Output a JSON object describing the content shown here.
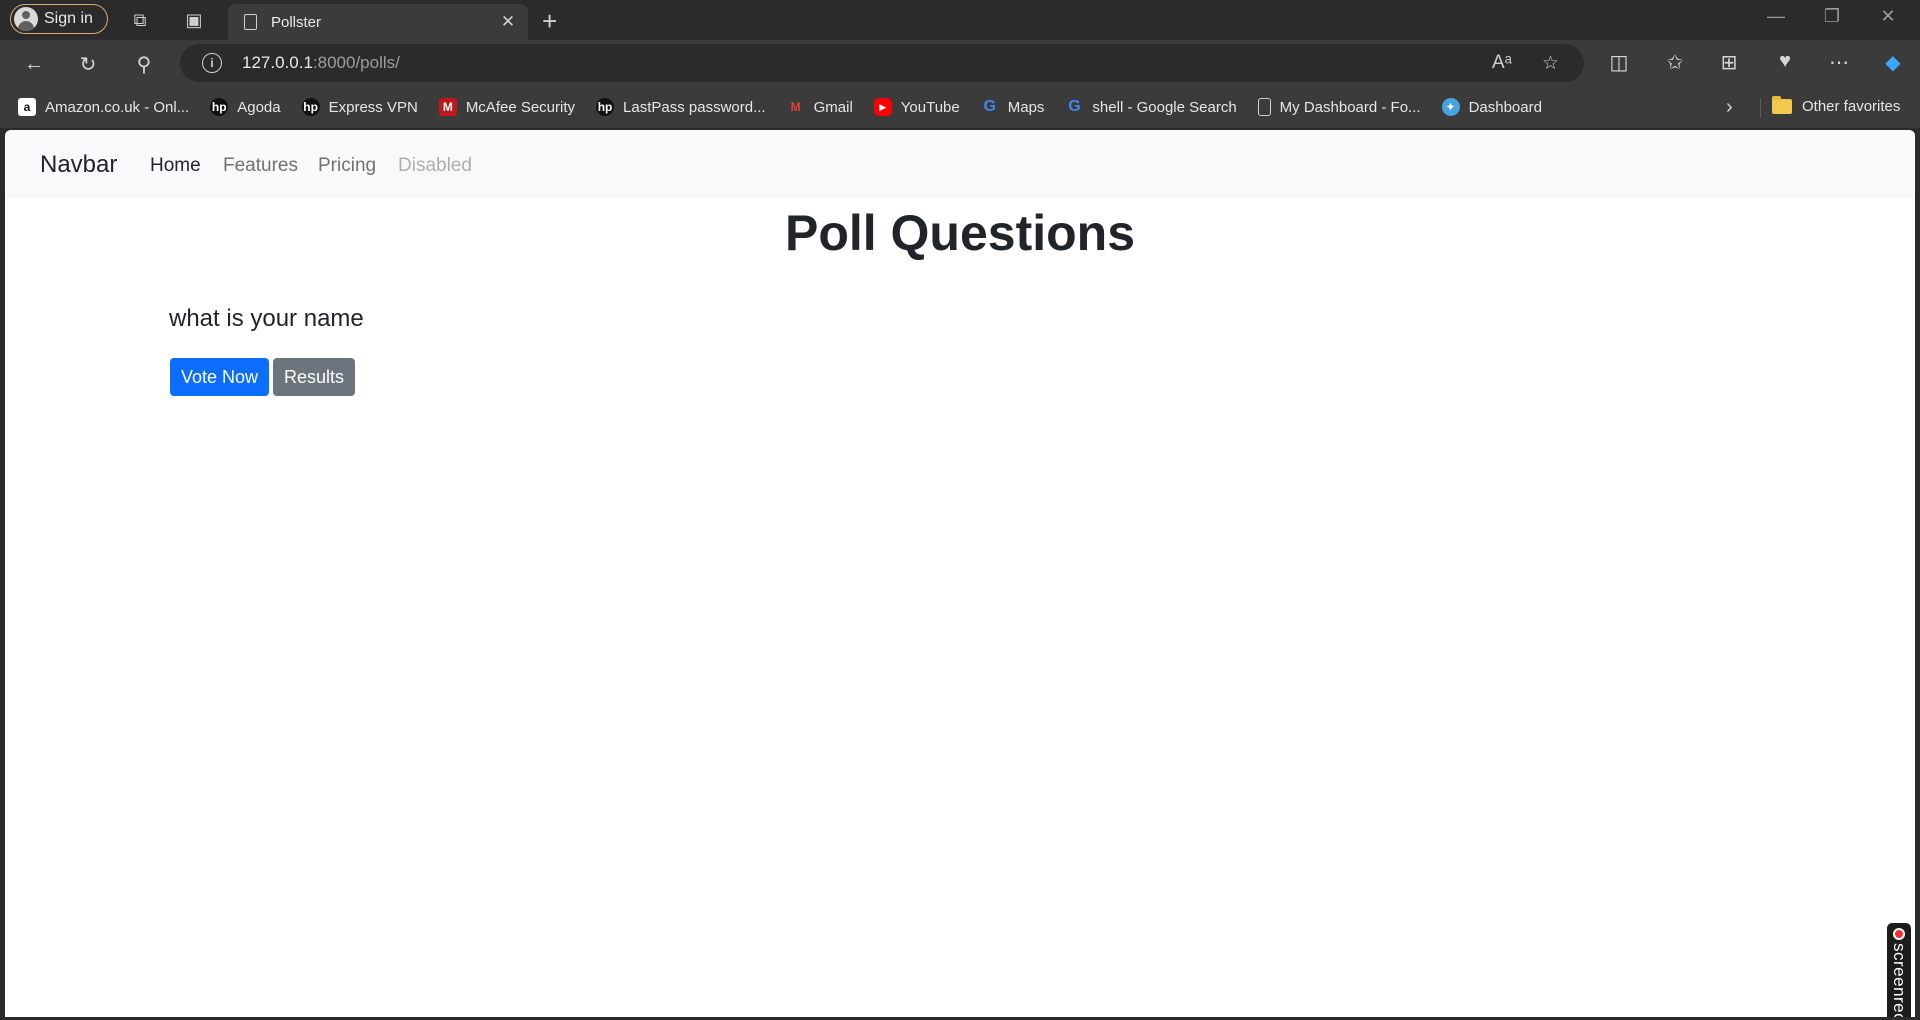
{
  "browser": {
    "signin_label": "Sign in",
    "tab_title": "Pollster",
    "address": {
      "host": "127.0.0.1",
      "rest": ":8000/polls/"
    }
  },
  "favorites": [
    {
      "label": "Amazon.co.uk - Onl...",
      "icon": "amazon-icon",
      "color": "#ffffff"
    },
    {
      "label": "Agoda",
      "icon": "hp-icon",
      "color": "#111111"
    },
    {
      "label": "Express VPN",
      "icon": "hp-icon",
      "color": "#111111"
    },
    {
      "label": "McAfee Security",
      "icon": "mcafee-icon",
      "color": "#c01818"
    },
    {
      "label": "LastPass password...",
      "icon": "hp-icon",
      "color": "#111111"
    },
    {
      "label": "Gmail",
      "icon": "gmail-icon",
      "color": "#ea4335"
    },
    {
      "label": "YouTube",
      "icon": "youtube-icon",
      "color": "#ff0000"
    },
    {
      "label": "Maps",
      "icon": "google-icon",
      "color": "#4285f4"
    },
    {
      "label": "shell - Google Search",
      "icon": "google-icon",
      "color": "#4285f4"
    },
    {
      "label": "My Dashboard - Fo...",
      "icon": "page-icon",
      "color": "#3b3b3b"
    },
    {
      "label": "Dashboard",
      "icon": "dashboard-icon",
      "color": "#4aa3df"
    }
  ],
  "other_favorites": "Other favorites",
  "site": {
    "brand": "Navbar",
    "nav": [
      "Home",
      "Features",
      "Pricing",
      "Disabled"
    ],
    "title": "Poll Questions",
    "question": "what is your name",
    "vote_label": "Vote Now",
    "results_label": "Results"
  },
  "screenrec_label": "screenrec"
}
